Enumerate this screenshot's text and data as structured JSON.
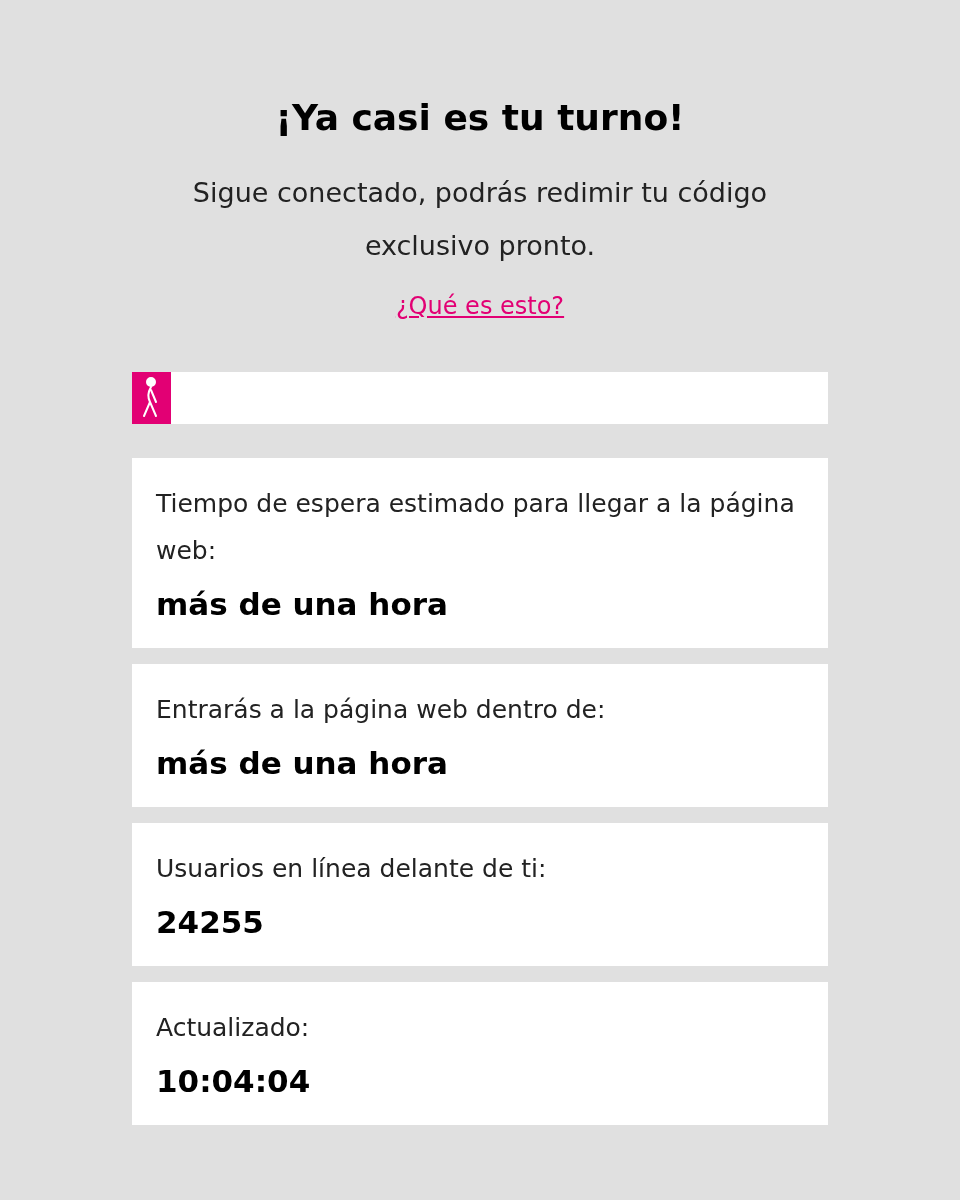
{
  "heading": "¡Ya casi es tu turno!",
  "subtitle": "Sigue conectado, podrás redimir tu código exclusivo pronto.",
  "info_link": "¿Qué es esto?",
  "queue_progress": {
    "level": 0.056
  },
  "cards": [
    {
      "label": "Tiempo de espera estimado para llegar a la página web:",
      "value": "más de una hora"
    },
    {
      "label": "Entrarás a la página web dentro de:",
      "value": "más de una hora"
    },
    {
      "label": "Usuarios en línea delante de ti:",
      "value": "24255"
    },
    {
      "label": "Actualizado:",
      "value": "10:04:04"
    }
  ]
}
